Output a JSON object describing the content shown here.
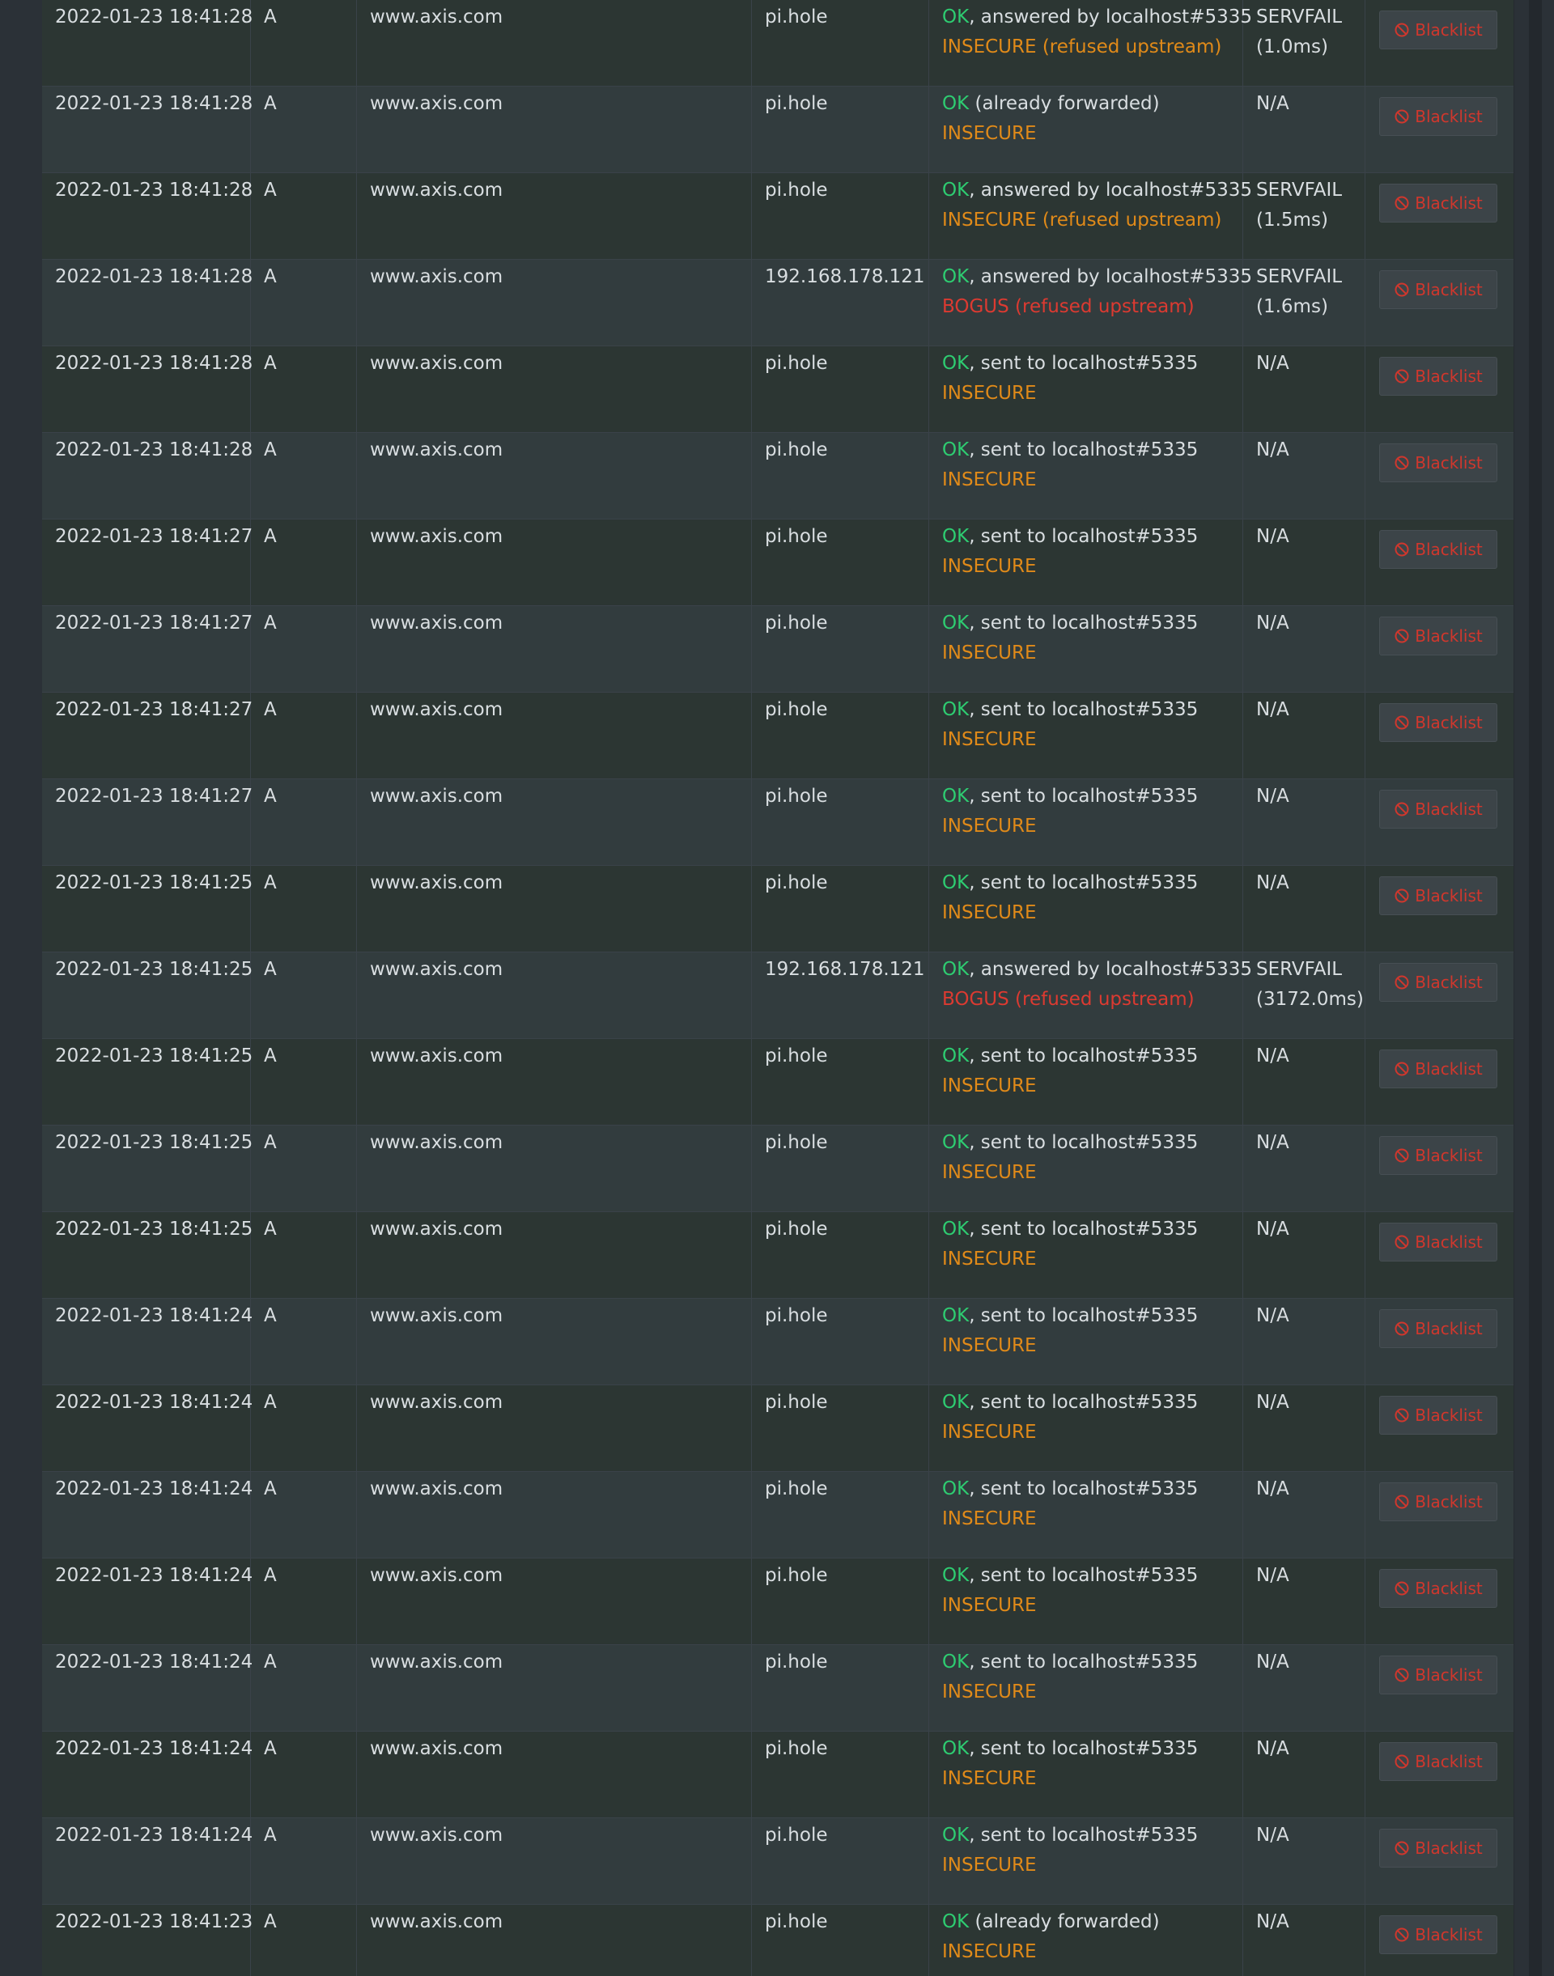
{
  "blacklist_label": "Blacklist",
  "colors": {
    "ok": "#2ecc71",
    "insecure": "#e08a19",
    "bogus": "#dc3a31",
    "row_dark": "#2c3633",
    "row_light": "#323c3e",
    "button_text": "#d0372d"
  },
  "rows": [
    {
      "time": "2022-01-23 18:41:28",
      "type": "A",
      "domain": "www.axis.com",
      "client": "pi.hole",
      "ok": "OK",
      "status_rest": ", answered by localhost#5335",
      "dnssec": "INSECURE (refused upstream)",
      "dnssec_level": "insecure",
      "reply": "SERVFAIL",
      "reply_time": "(1.0ms)"
    },
    {
      "time": "2022-01-23 18:41:28",
      "type": "A",
      "domain": "www.axis.com",
      "client": "pi.hole",
      "ok": "OK",
      "status_rest": " (already forwarded)",
      "dnssec": "INSECURE",
      "dnssec_level": "insecure",
      "reply": "N/A",
      "reply_time": ""
    },
    {
      "time": "2022-01-23 18:41:28",
      "type": "A",
      "domain": "www.axis.com",
      "client": "pi.hole",
      "ok": "OK",
      "status_rest": ", answered by localhost#5335",
      "dnssec": "INSECURE (refused upstream)",
      "dnssec_level": "insecure",
      "reply": "SERVFAIL",
      "reply_time": "(1.5ms)"
    },
    {
      "time": "2022-01-23 18:41:28",
      "type": "A",
      "domain": "www.axis.com",
      "client": "192.168.178.121",
      "ok": "OK",
      "status_rest": ", answered by localhost#5335",
      "dnssec": "BOGUS (refused upstream)",
      "dnssec_level": "bogus",
      "reply": "SERVFAIL",
      "reply_time": "(1.6ms)"
    },
    {
      "time": "2022-01-23 18:41:28",
      "type": "A",
      "domain": "www.axis.com",
      "client": "pi.hole",
      "ok": "OK",
      "status_rest": ", sent to localhost#5335",
      "dnssec": "INSECURE",
      "dnssec_level": "insecure",
      "reply": "N/A",
      "reply_time": ""
    },
    {
      "time": "2022-01-23 18:41:28",
      "type": "A",
      "domain": "www.axis.com",
      "client": "pi.hole",
      "ok": "OK",
      "status_rest": ", sent to localhost#5335",
      "dnssec": "INSECURE",
      "dnssec_level": "insecure",
      "reply": "N/A",
      "reply_time": ""
    },
    {
      "time": "2022-01-23 18:41:27",
      "type": "A",
      "domain": "www.axis.com",
      "client": "pi.hole",
      "ok": "OK",
      "status_rest": ", sent to localhost#5335",
      "dnssec": "INSECURE",
      "dnssec_level": "insecure",
      "reply": "N/A",
      "reply_time": ""
    },
    {
      "time": "2022-01-23 18:41:27",
      "type": "A",
      "domain": "www.axis.com",
      "client": "pi.hole",
      "ok": "OK",
      "status_rest": ", sent to localhost#5335",
      "dnssec": "INSECURE",
      "dnssec_level": "insecure",
      "reply": "N/A",
      "reply_time": ""
    },
    {
      "time": "2022-01-23 18:41:27",
      "type": "A",
      "domain": "www.axis.com",
      "client": "pi.hole",
      "ok": "OK",
      "status_rest": ", sent to localhost#5335",
      "dnssec": "INSECURE",
      "dnssec_level": "insecure",
      "reply": "N/A",
      "reply_time": ""
    },
    {
      "time": "2022-01-23 18:41:27",
      "type": "A",
      "domain": "www.axis.com",
      "client": "pi.hole",
      "ok": "OK",
      "status_rest": ", sent to localhost#5335",
      "dnssec": "INSECURE",
      "dnssec_level": "insecure",
      "reply": "N/A",
      "reply_time": ""
    },
    {
      "time": "2022-01-23 18:41:25",
      "type": "A",
      "domain": "www.axis.com",
      "client": "pi.hole",
      "ok": "OK",
      "status_rest": ", sent to localhost#5335",
      "dnssec": "INSECURE",
      "dnssec_level": "insecure",
      "reply": "N/A",
      "reply_time": ""
    },
    {
      "time": "2022-01-23 18:41:25",
      "type": "A",
      "domain": "www.axis.com",
      "client": "192.168.178.121",
      "ok": "OK",
      "status_rest": ", answered by localhost#5335",
      "dnssec": "BOGUS (refused upstream)",
      "dnssec_level": "bogus",
      "reply": "SERVFAIL",
      "reply_time": "(3172.0ms)"
    },
    {
      "time": "2022-01-23 18:41:25",
      "type": "A",
      "domain": "www.axis.com",
      "client": "pi.hole",
      "ok": "OK",
      "status_rest": ", sent to localhost#5335",
      "dnssec": "INSECURE",
      "dnssec_level": "insecure",
      "reply": "N/A",
      "reply_time": ""
    },
    {
      "time": "2022-01-23 18:41:25",
      "type": "A",
      "domain": "www.axis.com",
      "client": "pi.hole",
      "ok": "OK",
      "status_rest": ", sent to localhost#5335",
      "dnssec": "INSECURE",
      "dnssec_level": "insecure",
      "reply": "N/A",
      "reply_time": ""
    },
    {
      "time": "2022-01-23 18:41:25",
      "type": "A",
      "domain": "www.axis.com",
      "client": "pi.hole",
      "ok": "OK",
      "status_rest": ", sent to localhost#5335",
      "dnssec": "INSECURE",
      "dnssec_level": "insecure",
      "reply": "N/A",
      "reply_time": ""
    },
    {
      "time": "2022-01-23 18:41:24",
      "type": "A",
      "domain": "www.axis.com",
      "client": "pi.hole",
      "ok": "OK",
      "status_rest": ", sent to localhost#5335",
      "dnssec": "INSECURE",
      "dnssec_level": "insecure",
      "reply": "N/A",
      "reply_time": ""
    },
    {
      "time": "2022-01-23 18:41:24",
      "type": "A",
      "domain": "www.axis.com",
      "client": "pi.hole",
      "ok": "OK",
      "status_rest": ", sent to localhost#5335",
      "dnssec": "INSECURE",
      "dnssec_level": "insecure",
      "reply": "N/A",
      "reply_time": ""
    },
    {
      "time": "2022-01-23 18:41:24",
      "type": "A",
      "domain": "www.axis.com",
      "client": "pi.hole",
      "ok": "OK",
      "status_rest": ", sent to localhost#5335",
      "dnssec": "INSECURE",
      "dnssec_level": "insecure",
      "reply": "N/A",
      "reply_time": ""
    },
    {
      "time": "2022-01-23 18:41:24",
      "type": "A",
      "domain": "www.axis.com",
      "client": "pi.hole",
      "ok": "OK",
      "status_rest": ", sent to localhost#5335",
      "dnssec": "INSECURE",
      "dnssec_level": "insecure",
      "reply": "N/A",
      "reply_time": ""
    },
    {
      "time": "2022-01-23 18:41:24",
      "type": "A",
      "domain": "www.axis.com",
      "client": "pi.hole",
      "ok": "OK",
      "status_rest": ", sent to localhost#5335",
      "dnssec": "INSECURE",
      "dnssec_level": "insecure",
      "reply": "N/A",
      "reply_time": ""
    },
    {
      "time": "2022-01-23 18:41:24",
      "type": "A",
      "domain": "www.axis.com",
      "client": "pi.hole",
      "ok": "OK",
      "status_rest": ", sent to localhost#5335",
      "dnssec": "INSECURE",
      "dnssec_level": "insecure",
      "reply": "N/A",
      "reply_time": ""
    },
    {
      "time": "2022-01-23 18:41:24",
      "type": "A",
      "domain": "www.axis.com",
      "client": "pi.hole",
      "ok": "OK",
      "status_rest": ", sent to localhost#5335",
      "dnssec": "INSECURE",
      "dnssec_level": "insecure",
      "reply": "N/A",
      "reply_time": ""
    },
    {
      "time": "2022-01-23 18:41:23",
      "type": "A",
      "domain": "www.axis.com",
      "client": "pi.hole",
      "ok": "OK",
      "status_rest": " (already forwarded)",
      "dnssec": "INSECURE",
      "dnssec_level": "insecure",
      "reply": "N/A",
      "reply_time": ""
    }
  ]
}
